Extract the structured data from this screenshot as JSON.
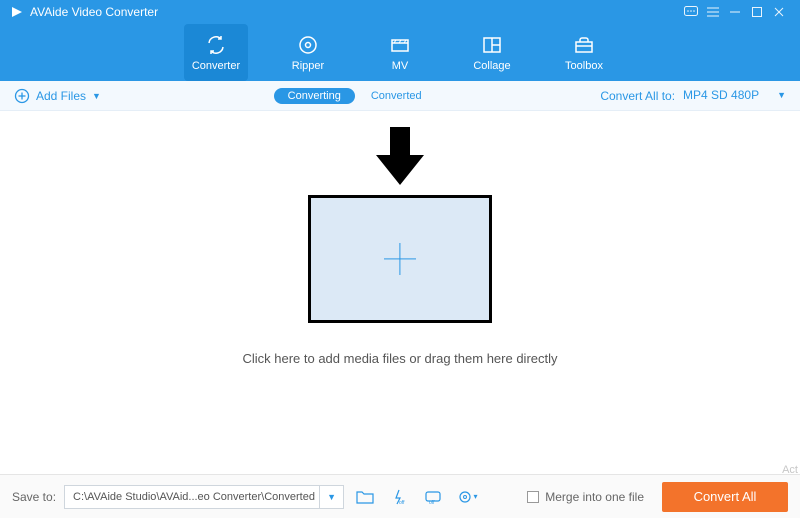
{
  "app": {
    "title": "AVAide Video Converter"
  },
  "nav": {
    "items": [
      {
        "label": "Converter"
      },
      {
        "label": "Ripper"
      },
      {
        "label": "MV"
      },
      {
        "label": "Collage"
      },
      {
        "label": "Toolbox"
      }
    ]
  },
  "subbar": {
    "add_files": "Add Files",
    "tab_converting": "Converting",
    "tab_converted": "Converted",
    "convert_all_to": "Convert All to:",
    "format": "MP4 SD 480P"
  },
  "main": {
    "hint": "Click here to add media files or drag them here directly"
  },
  "bottom": {
    "save_to": "Save to:",
    "path": "C:\\AVAide Studio\\AVAid...eo Converter\\Converted",
    "merge": "Merge into one file",
    "convert_all": "Convert All"
  },
  "watermark": "Act"
}
